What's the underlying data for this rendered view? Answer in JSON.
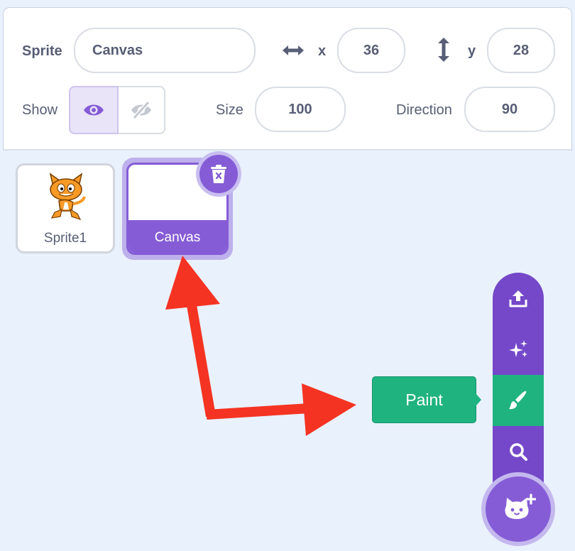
{
  "sprite_info": {
    "sprite_label": "Sprite",
    "sprite_name": "Canvas",
    "x_label": "x",
    "x_value": "36",
    "y_label": "y",
    "y_value": "28",
    "show_label": "Show",
    "size_label": "Size",
    "size_value": "100",
    "direction_label": "Direction",
    "direction_value": "90"
  },
  "sprites": [
    {
      "name": "Sprite1",
      "selected": false
    },
    {
      "name": "Canvas",
      "selected": true
    }
  ],
  "sprite_menu": {
    "items": [
      "upload-icon",
      "surprise-icon",
      "paint-icon",
      "search-icon"
    ],
    "active": "paint-icon",
    "tooltip": "Paint",
    "main_icon": "cat-plus-icon"
  },
  "colors": {
    "accent": "#855cd6",
    "menu": "#7448c9",
    "active": "#1fb380",
    "annotation": "#f53322",
    "text": "#575e75"
  }
}
